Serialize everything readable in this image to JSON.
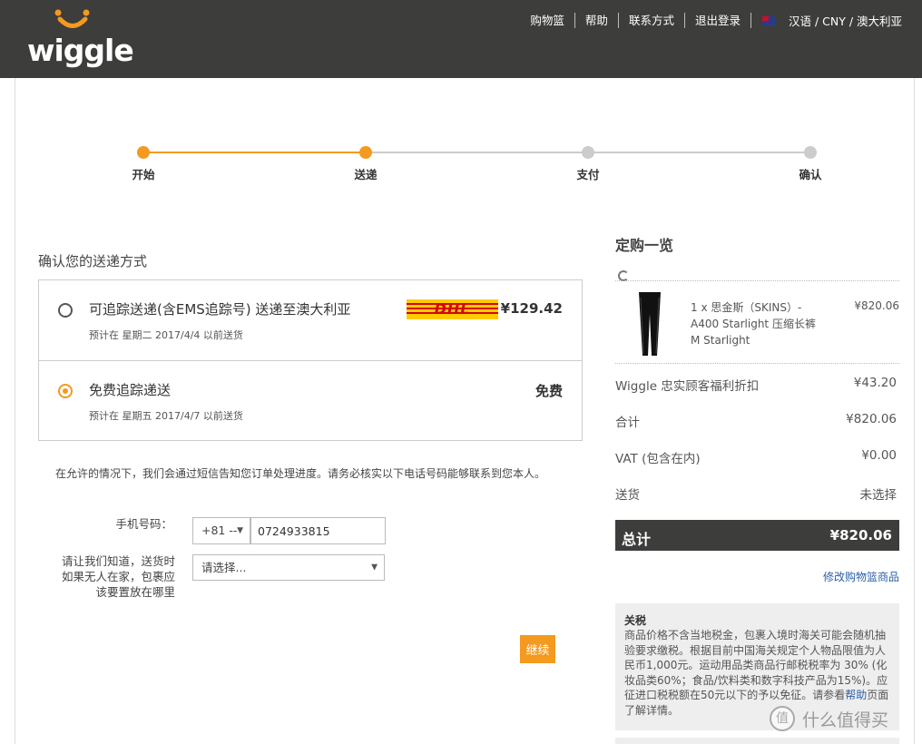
{
  "brand": {
    "logo_text": "wiggle",
    "accent": "#f39a1f",
    "header_bg": "#3d3d3b"
  },
  "topnav": {
    "links": [
      "购物篮",
      "帮助",
      "联系方式",
      "退出登录"
    ],
    "flag_icon": "australia-flag-icon",
    "locale": "汉语 / CNY / 澳大利亚"
  },
  "progress": {
    "steps": [
      "开始",
      "送递",
      "支付",
      "确认"
    ],
    "completed": 2
  },
  "delivery": {
    "title": "确认您的送递方式",
    "options": [
      {
        "title": "可追踪送递(含EMS追踪号) 送递至澳大利亚",
        "sub": "预计在 星期二 2017/4/4 以前送货",
        "price": "¥129.42",
        "carrier_logo": "DHL",
        "selected": false
      },
      {
        "title": "免费追踪递送",
        "sub": "预计在 星期五 2017/4/7 以前送货",
        "price": "免费",
        "selected": true
      }
    ]
  },
  "contact": {
    "notice": "在允许的情况下，我们会通过短信告知您订单处理进度。请务必核实以下电话号码能够联系到您本人。",
    "phone_label": "手机号码：",
    "country_code": "+81 --",
    "phone_value": "0724933815",
    "place_label": "请让我们知道，送货时如果无人在家，包裹应该要置放在哪里",
    "place_select": "请选择..."
  },
  "continue_label": "继续",
  "summary": {
    "title": "定购一览",
    "product": {
      "desc": "1 x 思金斯（SKINS）- A400 Starlight 压缩长裤 M Starlight",
      "price": "¥820.06"
    },
    "rows": [
      {
        "label": "Wiggle 忠实顾客福利折扣",
        "value": "¥43.20"
      },
      {
        "label": "合计",
        "value": "¥820.06"
      },
      {
        "label": "VAT (包含在内)",
        "value": "¥0.00"
      },
      {
        "label": "送货",
        "value": "未选择"
      }
    ],
    "total_label": "总计",
    "total_value": "¥820.06",
    "edit_link": "修改购物篮商品"
  },
  "tax": {
    "title": "关税",
    "text_before": "商品价格不含当地税金，包裹入境时海关可能会随机抽验要求缴税。根据目前中国海关规定个人物品限值为人民币1,000元。运动用品类商品行邮税税率为 30% (化妆品类60%；食品/饮料类和数字科技产品为15%)。应征进口税税额在50元以下的予以免征。请参看",
    "link": "帮助",
    "text_after": "页面了解详情。"
  },
  "watermark": {
    "icon": "值",
    "text": "什么值得买"
  }
}
